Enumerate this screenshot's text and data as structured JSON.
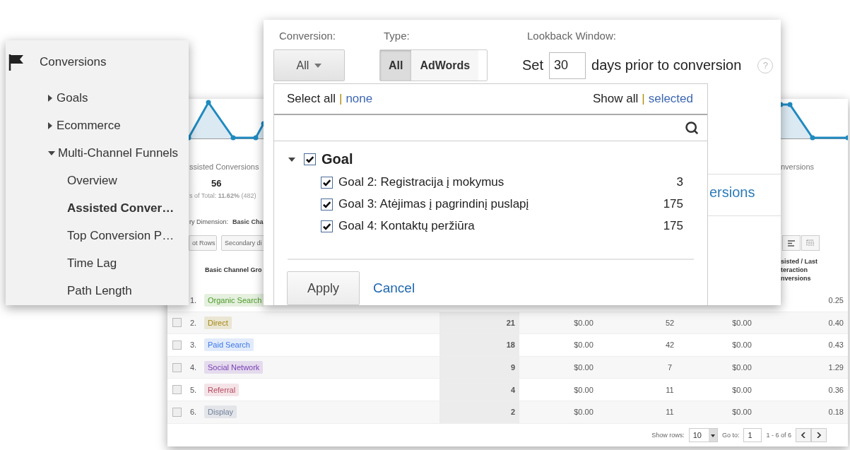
{
  "sidebar": {
    "title": "Conversions",
    "items": [
      {
        "label": "Goals",
        "expanded": false
      },
      {
        "label": "Ecommerce",
        "expanded": false
      },
      {
        "label": "Multi-Channel Funnels",
        "expanded": true,
        "children": [
          {
            "label": "Overview",
            "selected": false
          },
          {
            "label": "Assisted Conver…",
            "selected": true
          },
          {
            "label": "Top Conversion P…",
            "selected": false
          },
          {
            "label": "Time Lag",
            "selected": false
          },
          {
            "label": "Path Length",
            "selected": false
          }
        ]
      }
    ]
  },
  "report": {
    "metric_label": "ssisted Conversions",
    "metric_value": "56",
    "metric_total": "s of Total: **11.62%** (482)",
    "metric_label_right": "nversions",
    "dimension_label": "ry Dimension:",
    "dimension_value": "Basic Cha",
    "buttons": [
      "ot Rows",
      "Secondary di"
    ],
    "column_1": "Basic Channel Gro",
    "column_right": [
      "sisted / Last",
      "teraction",
      "nversions"
    ],
    "rows": [
      {
        "kind": "partial",
        "number": "1.",
        "channel": "Organic Search",
        "color": "#4e9a2a",
        "cells": [
          "",
          "",
          "",
          "",
          "0.25"
        ]
      },
      {
        "kind": "full",
        "checked": false,
        "number": "2.",
        "channel": "Direct",
        "color": "#a4860f",
        "cells": [
          "21",
          "$0.00",
          "52",
          "$0.00",
          "0.40"
        ]
      },
      {
        "kind": "full",
        "checked": false,
        "number": "3.",
        "channel": "Paid Search",
        "color": "#3b78e7",
        "cells": [
          "18",
          "$0.00",
          "42",
          "$0.00",
          "0.43"
        ]
      },
      {
        "kind": "full",
        "checked": false,
        "number": "4.",
        "channel": "Social Network",
        "color": "#7a3fb5",
        "cells": [
          "9",
          "$0.00",
          "7",
          "$0.00",
          "1.29"
        ]
      },
      {
        "kind": "full",
        "checked": false,
        "number": "5.",
        "channel": "Referral",
        "color": "#b5485f",
        "cells": [
          "4",
          "$0.00",
          "11",
          "$0.00",
          "0.36"
        ]
      },
      {
        "kind": "full",
        "checked": false,
        "number": "6.",
        "channel": "Display",
        "color": "#6f7f99",
        "cells": [
          "2",
          "$0.00",
          "11",
          "$0.00",
          "0.18"
        ]
      }
    ],
    "footer": {
      "show_rows_label": "Show rows:",
      "show_rows_value": "10",
      "goto_label": "Go to:",
      "goto_value": "1",
      "range": "1 - 6 of 6"
    }
  },
  "popup": {
    "conversion_label": "Conversion:",
    "conversion_value": "All",
    "type_label": "Type:",
    "type_options": [
      {
        "label": "All",
        "selected": true
      },
      {
        "label": "AdWords",
        "selected": false
      }
    ],
    "lookback_label": "Lookback Window:",
    "set_label": "Set",
    "days_value": "30",
    "days_suffix": "days prior to conversion",
    "help": "?",
    "behind_text": "ersions",
    "dropdown": {
      "select_all": "Select all",
      "separator_1": "|",
      "none": "none",
      "show_all": "Show all",
      "separator_2": "|",
      "selected_link": "selected",
      "tree": {
        "label": "Goal",
        "checked": true,
        "expanded": true,
        "children": [
          {
            "label": "Goal 2: Registracija į mokymus",
            "count": "3",
            "checked": true
          },
          {
            "label": "Goal 3: Atėjimas į pagrindinį puslapį",
            "count": "175",
            "checked": true
          },
          {
            "label": "Goal 4: Kontaktų peržiūra",
            "count": "175",
            "checked": true
          }
        ]
      },
      "apply": "Apply",
      "cancel": "Cancel"
    }
  }
}
